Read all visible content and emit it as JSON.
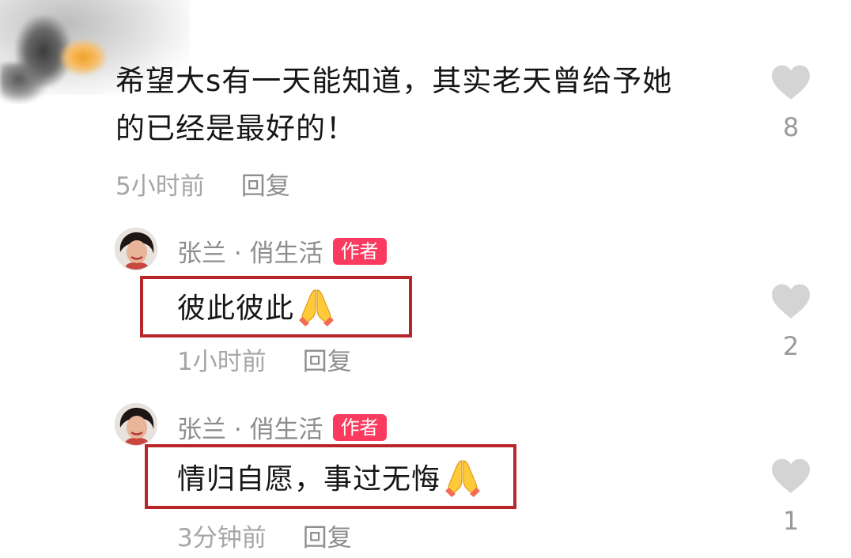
{
  "comment": {
    "line1": "希望大s有一天能知道，其实老天曾给予她",
    "line2": "的已经是最好的！",
    "time": "5小时前",
    "reply_label": "回复",
    "likes": "8",
    "icons": {
      "like": "heart-icon"
    }
  },
  "replies": [
    {
      "author": "张兰 · 俏生活",
      "badge": "作者",
      "text": "彼此彼此",
      "emoji": "folded-hands-icon",
      "time": "1小时前",
      "reply_label": "回复",
      "likes": "2"
    },
    {
      "author": "张兰 · 俏生活",
      "badge": "作者",
      "text": "情归自愿，事过无悔",
      "emoji": "folded-hands-icon",
      "time": "3分钟前",
      "reply_label": "回复",
      "likes": "1"
    }
  ],
  "colors": {
    "badge": "#fb3a5f",
    "highlight": "#b8262a",
    "heart": "#d4d4d4"
  }
}
